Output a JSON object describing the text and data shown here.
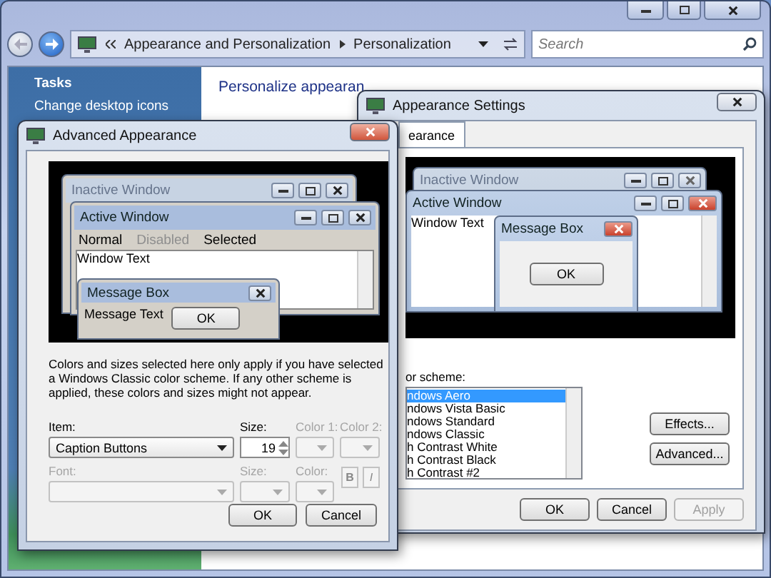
{
  "explorer": {
    "breadcrumb": [
      "Appearance and Personalization",
      "Personalization"
    ],
    "search": {
      "placeholder": "Search"
    },
    "sidebar": {
      "heading": "Tasks",
      "items": [
        "Change desktop icons"
      ]
    },
    "heading": "Personalize appearan"
  },
  "appearance_settings": {
    "title": "Appearance Settings",
    "tabs": [
      {
        "label": "earance",
        "selected": true
      }
    ],
    "preview": {
      "inactive_title": "Inactive Window",
      "active_title": "Active Window",
      "window_text": "Window Text",
      "message_box_title": "Message Box",
      "ok": "OK"
    },
    "scheme_label": "or scheme:",
    "schemes": [
      {
        "label": "ndows Aero",
        "selected": true
      },
      {
        "label": "ndows Vista Basic",
        "selected": false
      },
      {
        "label": "ndows Standard",
        "selected": false
      },
      {
        "label": "ndows Classic",
        "selected": false
      },
      {
        "label": "h Contrast White",
        "selected": false
      },
      {
        "label": "h Contrast Black",
        "selected": false
      },
      {
        "label": "h Contrast #2",
        "selected": false
      }
    ],
    "side_buttons": [
      "Effects...",
      "Advanced..."
    ],
    "footer_buttons": [
      {
        "label": "OK",
        "disabled": false
      },
      {
        "label": "Cancel",
        "disabled": false
      },
      {
        "label": "Apply",
        "disabled": true
      }
    ]
  },
  "advanced_appearance": {
    "title": "Advanced Appearance",
    "preview": {
      "inactive_title": "Inactive Window",
      "active_title": "Active Window",
      "menu": [
        {
          "label": "Normal",
          "kind": "normal"
        },
        {
          "label": "Disabled",
          "kind": "disabled"
        },
        {
          "label": "Selected",
          "kind": "selected"
        }
      ],
      "window_text": "Window Text",
      "message_box_title": "Message Box",
      "message_text": "Message Text",
      "ok": "OK"
    },
    "description": "Colors and sizes selected here only apply if you have selected a Windows Classic color scheme. If any other scheme is applied, these colors and sizes might not appear.",
    "row1": [
      {
        "kind": "select",
        "label": "Item:",
        "value": "Caption Buttons",
        "disabled": false
      },
      {
        "kind": "spin",
        "label": "Size:",
        "value": "19",
        "disabled": false
      },
      {
        "kind": "color",
        "label": "Color 1:",
        "disabled": true
      },
      {
        "kind": "color",
        "label": "Color 2:",
        "disabled": true
      }
    ],
    "row2": [
      {
        "kind": "select",
        "label": "Font:",
        "disabled": true
      },
      {
        "kind": "select",
        "label": "Size:",
        "disabled": true
      },
      {
        "kind": "color",
        "label": "Color:",
        "disabled": true
      },
      {
        "kind": "style",
        "buttons": [
          "B",
          "I"
        ],
        "disabled": true
      }
    ],
    "buttons": [
      "OK",
      "Cancel"
    ]
  }
}
